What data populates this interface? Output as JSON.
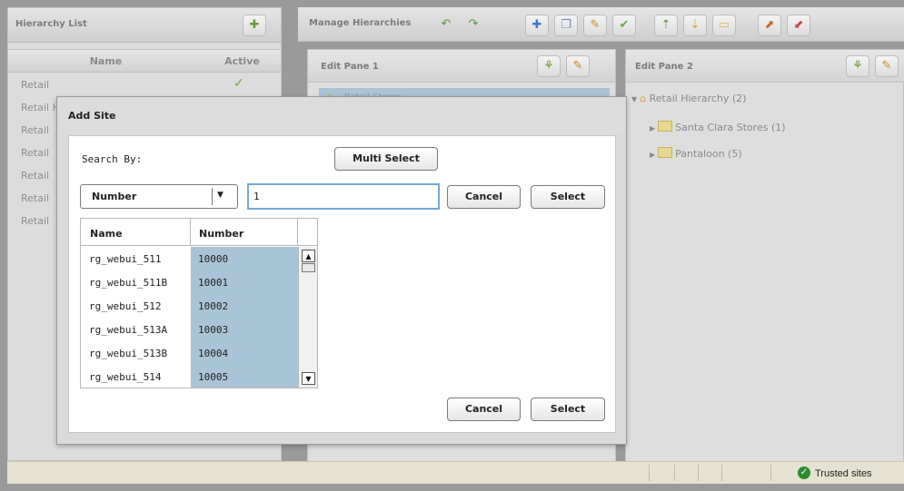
{
  "hierarchy_list": {
    "title": "Hierarchy List",
    "columns": {
      "name": "Name",
      "active": "Active"
    },
    "rows": [
      {
        "name": "Retail",
        "active": "✓"
      },
      {
        "name": "Retail Hierarchy",
        "active": "✓"
      },
      {
        "name": "Retail",
        "active": "✓"
      },
      {
        "name": "Retail",
        "active": ""
      },
      {
        "name": "Retail",
        "active": ""
      },
      {
        "name": "Retail",
        "active": ""
      },
      {
        "name": "Retail",
        "active": ""
      }
    ]
  },
  "manage": {
    "title": "Manage Hierarchies",
    "toolbar_icons": [
      "undo-icon",
      "redo-icon",
      "add-icon",
      "copy-icon",
      "edit-icon",
      "check-icon",
      "move-up-icon",
      "move-down-icon",
      "folder-icon",
      "export-icon",
      "import-icon"
    ]
  },
  "edit_pane_1": {
    "title": "Edit Pane 1",
    "selected_item": "Retail Stores"
  },
  "edit_pane_2": {
    "title": "Edit Pane 2",
    "tree": {
      "root": "Retail Hierarchy (2)",
      "children": [
        "Santa Clara Stores (1)",
        "Pantaloon (5)"
      ]
    }
  },
  "status_bar": {
    "zone_label": "Trusted sites"
  },
  "dialog": {
    "title": "Add Site",
    "search_by_label": "Search By:",
    "multi_select_label": "Multi Select",
    "search_by_value": "Number",
    "search_value": "1",
    "cancel_label": "Cancel",
    "select_label": "Select",
    "results": {
      "columns": {
        "name": "Name",
        "number": "Number"
      },
      "rows": [
        {
          "name": "rg_webui_511",
          "number": "10000"
        },
        {
          "name": "rg_webui_511B",
          "number": "10001"
        },
        {
          "name": "rg_webui_512",
          "number": "10002"
        },
        {
          "name": "rg_webui_513A",
          "number": "10003"
        },
        {
          "name": "rg_webui_513B",
          "number": "10004"
        },
        {
          "name": "rg_webui_514",
          "number": "10005"
        }
      ]
    }
  }
}
